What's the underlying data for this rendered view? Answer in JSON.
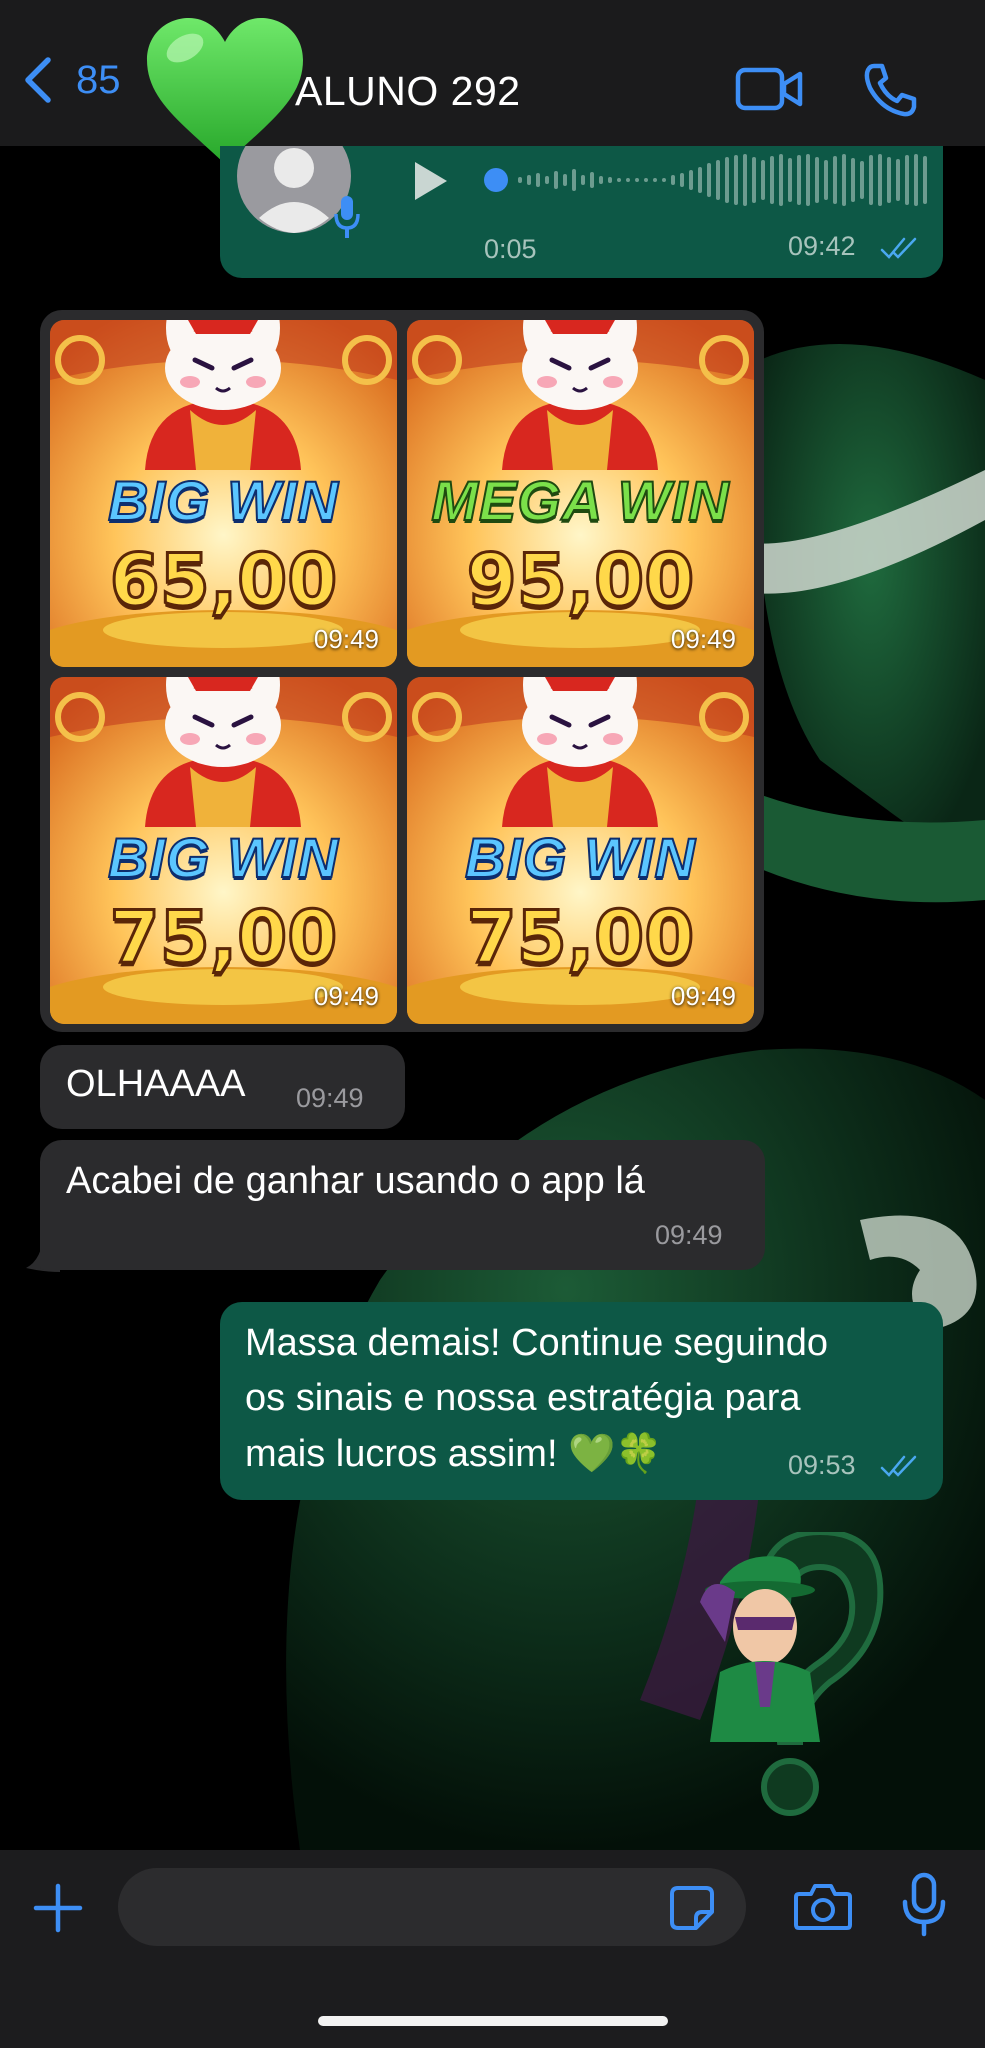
{
  "header": {
    "back_count": "85",
    "contact_name": "ALUNO 292",
    "icons": [
      "chevron-left-icon",
      "green-heart-avatar",
      "video-camera-icon",
      "phone-icon"
    ]
  },
  "voice_message": {
    "duration": "0:05",
    "time": "09:42",
    "status": "read"
  },
  "image_grid": {
    "tiles": [
      {
        "label": "BIG WIN",
        "amount": "65,00",
        "time": "09:49",
        "variant": "big"
      },
      {
        "label": "MEGA WIN",
        "amount": "95,00",
        "time": "09:49",
        "variant": "mega"
      },
      {
        "label": "BIG WIN",
        "amount": "75,00",
        "time": "09:49",
        "variant": "big"
      },
      {
        "label": "BIG WIN",
        "amount": "75,00",
        "time": "09:49",
        "variant": "big"
      }
    ]
  },
  "messages": {
    "in1": {
      "text": "OLHAAAA",
      "time": "09:49"
    },
    "in2": {
      "text": "Acabei de ganhar usando o app lá",
      "time": "09:49"
    },
    "out1": {
      "lines": [
        "Massa demais! Continue seguindo",
        "os sinais e nossa estratégia para",
        "mais lucros assim! 💚🍀"
      ],
      "time": "09:53",
      "status": "read"
    }
  },
  "composer": {
    "placeholder": "",
    "icons": [
      "plus-icon",
      "sticker-icon",
      "camera-icon",
      "microphone-icon"
    ]
  },
  "colors": {
    "accent": "#3d8ef5",
    "outgoing_bubble": "#0d5846",
    "incoming_bubble": "#2b2b2d",
    "header_bg": "#1c1c1e",
    "heart": "#3cc93c"
  }
}
